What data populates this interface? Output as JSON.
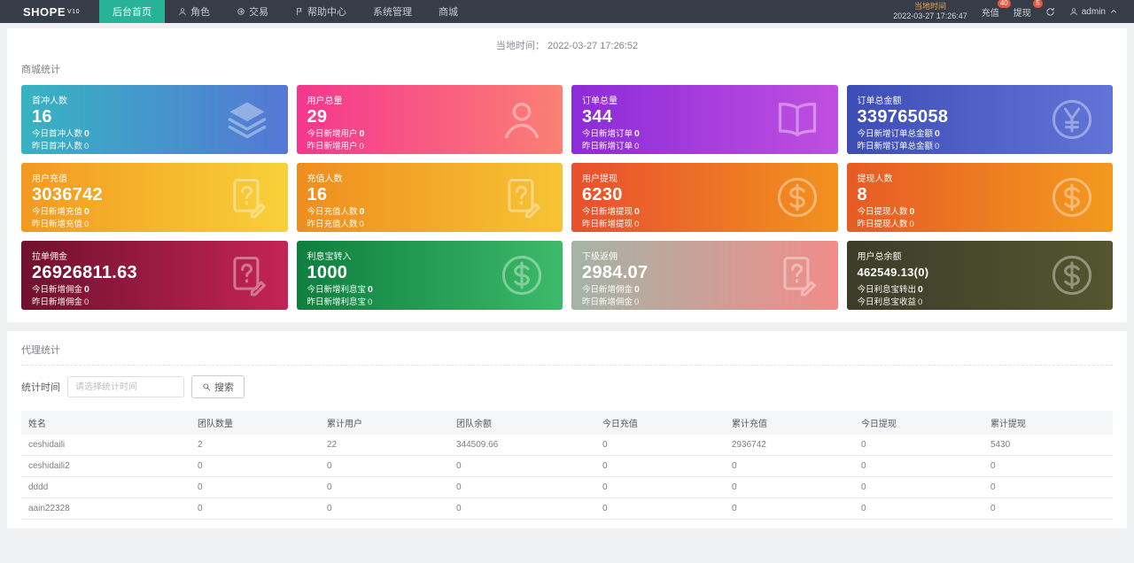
{
  "navbar": {
    "logo": "SHOPE",
    "logo_sup": "V10",
    "items": [
      {
        "label": "后台首页",
        "icon": null,
        "active": true
      },
      {
        "label": "角色",
        "icon": "user-icon",
        "active": false
      },
      {
        "label": "交易",
        "icon": "trade-icon",
        "active": false
      },
      {
        "label": "帮助中心",
        "icon": "flag-icon",
        "active": false
      },
      {
        "label": "系统管理",
        "icon": null,
        "active": false
      },
      {
        "label": "商城",
        "icon": null,
        "active": false
      }
    ],
    "time_label": "当地时间",
    "time_value": "2022-03-27 17:26:47",
    "recharge": {
      "label": "充值",
      "badge": "40"
    },
    "withdraw": {
      "label": "提现",
      "badge": "5"
    },
    "username": "admin",
    "active_color": "#27b397",
    "badge_color": "#e8573f"
  },
  "timebar": {
    "label": "当地时间：",
    "value": "2022-03-27 17:26:52"
  },
  "stats": {
    "section_title": "商城统计",
    "cards": [
      {
        "title": "首冲人数",
        "value": "16",
        "line1_label": "今日首冲人数",
        "line1_value": "0",
        "line2_label": "昨日首冲人数",
        "line2_value": "0",
        "icon": "layers-icon",
        "gradient": [
          "#36b4c1",
          "#5577d6"
        ],
        "small_value": false
      },
      {
        "title": "用户总量",
        "value": "29",
        "line1_label": "今日新增用户",
        "line1_value": "0",
        "line2_label": "昨日新增用户",
        "line2_value": "0",
        "icon": "user-icon",
        "gradient": [
          "#f5368f",
          "#fb8074"
        ],
        "small_value": false
      },
      {
        "title": "订单总量",
        "value": "344",
        "line1_label": "今日新增订单",
        "line1_value": "0",
        "line2_label": "昨日新增订单",
        "line2_value": "0",
        "icon": "book-icon",
        "gradient": [
          "#8c2bd8",
          "#c04fe0"
        ],
        "small_value": false
      },
      {
        "title": "订单总金额",
        "value": "339765058",
        "line1_label": "今日新增订单总金额",
        "line1_value": "0",
        "line2_label": "昨日新增订单总金额",
        "line2_value": "0",
        "icon": "yen-circle-icon",
        "gradient": [
          "#3d4db6",
          "#6274d8"
        ],
        "small_value": false
      },
      {
        "title": "用户充值",
        "value": "3036742",
        "line1_label": "今日新增充值",
        "line1_value": "0",
        "line2_label": "昨日新增充值",
        "line2_value": "0",
        "icon": "doc-question-icon",
        "gradient": [
          "#f29920",
          "#f8d13a"
        ],
        "small_value": false
      },
      {
        "title": "充值人数",
        "value": "16",
        "line1_label": "今日充值人数",
        "line1_value": "0",
        "line2_label": "昨日充值人数",
        "line2_value": "0",
        "icon": "doc-question-icon",
        "gradient": [
          "#ef8d1e",
          "#f7c434"
        ],
        "small_value": false
      },
      {
        "title": "用户提现",
        "value": "6230",
        "line1_label": "今日新增提现",
        "line1_value": "0",
        "line2_label": "昨日新增提现",
        "line2_value": "0",
        "icon": "dollar-circle-icon",
        "gradient": [
          "#e84f2e",
          "#f2921e"
        ],
        "small_value": false
      },
      {
        "title": "提现人数",
        "value": "8",
        "line1_label": "今日提现人数",
        "line1_value": "0",
        "line2_label": "昨日提现人数",
        "line2_value": "0",
        "icon": "dollar-circle-icon",
        "gradient": [
          "#e75a25",
          "#f39a1e"
        ],
        "small_value": false
      },
      {
        "title": "拉单佣金",
        "value": "26926811.63",
        "line1_label": "今日新增佣金",
        "line1_value": "0",
        "line2_label": "昨日新增佣金",
        "line2_value": "0",
        "icon": "doc-question-icon",
        "gradient": [
          "#70102f",
          "#c42457"
        ],
        "small_value": false
      },
      {
        "title": "利息宝转入",
        "value": "1000",
        "line1_label": "今日新增利息宝",
        "line1_value": "0",
        "line2_label": "昨日新增利息宝",
        "line2_value": "0",
        "icon": "dollar-circle-icon",
        "gradient": [
          "#0e7f3e",
          "#3cba69"
        ],
        "small_value": false
      },
      {
        "title": "下级返佣",
        "value": "2984.07",
        "line1_label": "今日新增佣金",
        "line1_value": "0",
        "line2_label": "昨日新增佣金",
        "line2_value": "0",
        "icon": "doc-question-icon",
        "gradient": [
          "#a4b4a6",
          "#f18c89"
        ],
        "small_value": false
      },
      {
        "title": "用户总余额",
        "value": "462549.13(0)",
        "line1_label": "今日利息宝转出",
        "line1_value": "0",
        "line2_label": "今日利息宝收益",
        "line2_value": "0",
        "icon": "dollar-circle-icon",
        "gradient": [
          "#3b3d2a",
          "#54562f"
        ],
        "small_value": true
      }
    ]
  },
  "agent": {
    "section_title": "代理统计",
    "search": {
      "label": "统计时间",
      "placeholder": "请选择统计时间",
      "button": "搜索"
    },
    "table": {
      "headers": [
        "姓名",
        "团队数量",
        "累计用户",
        "团队余额",
        "今日充值",
        "累计充值",
        "今日提现",
        "累计提现"
      ],
      "rows": [
        [
          "ceshidaili",
          "2",
          "22",
          "344509.66",
          "0",
          "2936742",
          "0",
          "5430"
        ],
        [
          "ceshidaili2",
          "0",
          "0",
          "0",
          "0",
          "0",
          "0",
          "0"
        ],
        [
          "dddd",
          "0",
          "0",
          "0",
          "0",
          "0",
          "0",
          "0"
        ],
        [
          "aain22328",
          "0",
          "0",
          "0",
          "0",
          "0",
          "0",
          "0"
        ]
      ]
    }
  }
}
